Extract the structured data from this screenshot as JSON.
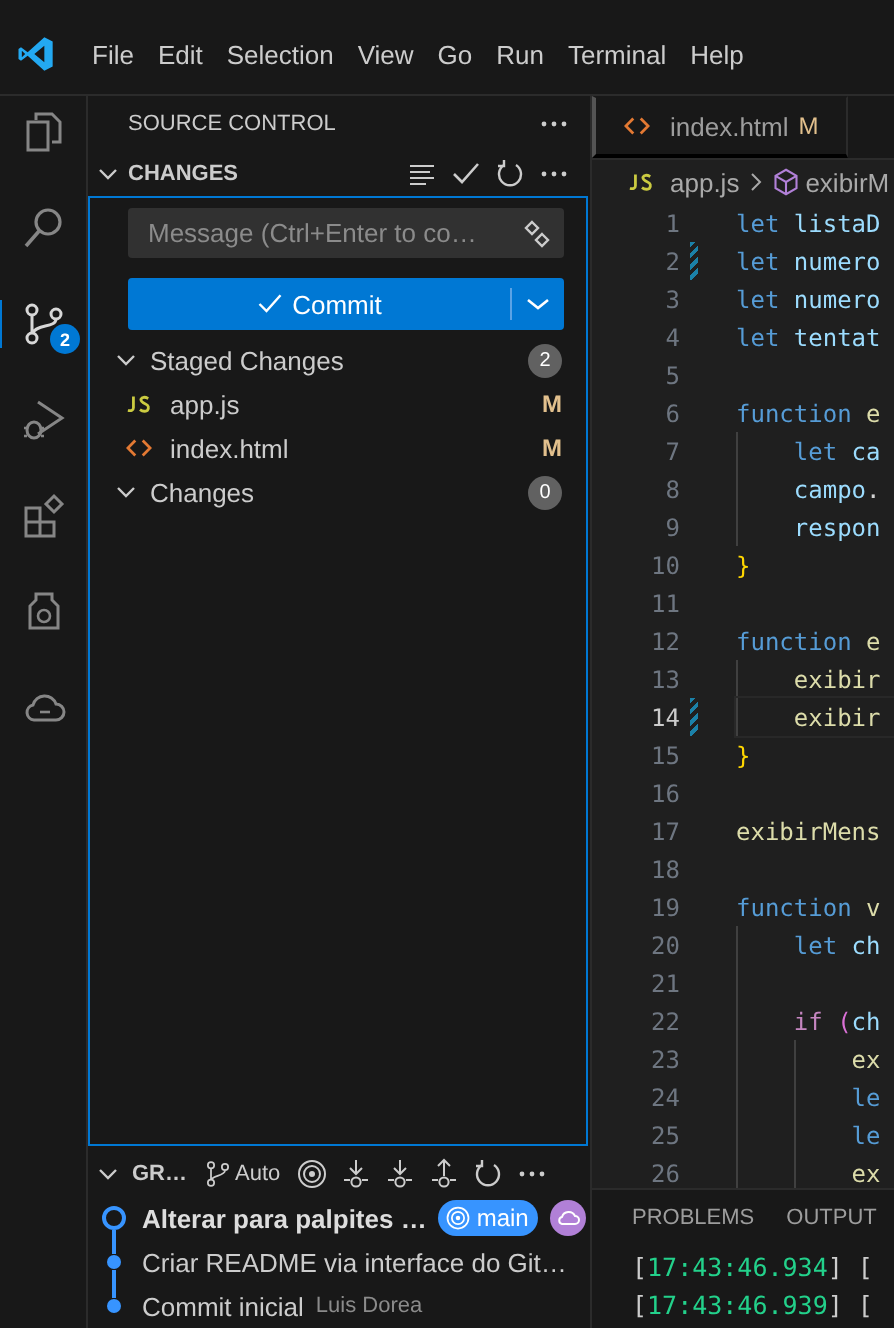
{
  "menu": [
    "File",
    "Edit",
    "Selection",
    "View",
    "Go",
    "Run",
    "Terminal",
    "Help"
  ],
  "activity_bar": [
    {
      "kind": "files",
      "selected": false
    },
    {
      "kind": "search",
      "selected": false
    },
    {
      "kind": "scm",
      "selected": true,
      "badge": "2"
    },
    {
      "kind": "debug",
      "selected": false
    },
    {
      "kind": "extensions",
      "selected": false
    },
    {
      "kind": "jar",
      "selected": false
    },
    {
      "kind": "cloud",
      "selected": false
    }
  ],
  "sidebar": {
    "title": "SOURCE CONTROL",
    "section": "CHANGES",
    "message": {
      "placeholder": "Message (Ctrl+Enter to co…"
    },
    "commit_button": "Commit",
    "groups": [
      {
        "label": "Staged Changes",
        "count": "2",
        "expanded": true,
        "files": [
          {
            "name": "app.js",
            "kind": "js",
            "status": "M"
          },
          {
            "name": "index.html",
            "kind": "html",
            "status": "M"
          }
        ]
      },
      {
        "label": "Changes",
        "count": "0",
        "expanded": true
      }
    ],
    "graph": {
      "title": "GR…",
      "branch_mode": "Auto",
      "commits": [
        {
          "message": "Alterar para palpites …",
          "current": true,
          "branch": "main"
        },
        {
          "message": "Criar README via interface do Git…",
          "current": false
        },
        {
          "message": "Commit inicial",
          "current": false,
          "author": "Luis Dorea"
        }
      ]
    }
  },
  "editor": {
    "tabs": [
      {
        "label": "index.html",
        "kind": "html",
        "status": "M",
        "selected": false
      }
    ],
    "breadcrumb": [
      "app.js",
      "exibirM"
    ],
    "lines": [
      {
        "number": "1",
        "kind": "top",
        "current": false,
        "modified": false,
        "tokens": [
          {
            "text": "let",
            "kind": "keyword"
          },
          {
            "text": " listaD",
            "kind": "variable"
          }
        ]
      },
      {
        "number": "2",
        "kind": "top",
        "current": false,
        "modified": true,
        "tokens": [
          {
            "text": "let",
            "kind": "keyword"
          },
          {
            "text": " numero",
            "kind": "variable"
          }
        ]
      },
      {
        "number": "3",
        "kind": "top",
        "current": false,
        "modified": false,
        "tokens": [
          {
            "text": "let",
            "kind": "keyword"
          },
          {
            "text": " numero",
            "kind": "variable"
          }
        ]
      },
      {
        "number": "4",
        "kind": "top",
        "current": false,
        "modified": false,
        "tokens": [
          {
            "text": "let",
            "kind": "keyword"
          },
          {
            "text": " tentat",
            "kind": "variable"
          }
        ]
      },
      {
        "number": "5",
        "kind": "top",
        "current": false,
        "modified": false
      },
      {
        "number": "6",
        "kind": "top",
        "current": false,
        "modified": false,
        "tokens": [
          {
            "text": "function",
            "kind": "keyword"
          },
          {
            "text": " e",
            "kind": "function"
          }
        ]
      },
      {
        "number": "7",
        "kind": "inner",
        "current": false,
        "modified": false,
        "tokens": [
          {
            "text": "let",
            "kind": "keyword"
          },
          {
            "text": " ca",
            "kind": "variable"
          }
        ]
      },
      {
        "number": "8",
        "kind": "inner",
        "current": false,
        "modified": false,
        "tokens": [
          {
            "text": "campo",
            "kind": "variable"
          },
          {
            "text": ".",
            "kind": "plain"
          }
        ]
      },
      {
        "number": "9",
        "kind": "inner",
        "current": false,
        "modified": false,
        "tokens": [
          {
            "text": "respon",
            "kind": "variable"
          }
        ]
      },
      {
        "number": "10",
        "kind": "top",
        "current": false,
        "modified": false,
        "tokens": [
          {
            "text": "}",
            "kind": "brace"
          }
        ]
      },
      {
        "number": "11",
        "kind": "top",
        "current": false,
        "modified": false
      },
      {
        "number": "12",
        "kind": "top",
        "current": false,
        "modified": false,
        "tokens": [
          {
            "text": "function",
            "kind": "keyword"
          },
          {
            "text": " e",
            "kind": "function"
          }
        ]
      },
      {
        "number": "13",
        "kind": "inner",
        "current": false,
        "modified": false,
        "tokens": [
          {
            "text": "exibir",
            "kind": "function"
          }
        ]
      },
      {
        "number": "14",
        "kind": "inner",
        "current": true,
        "modified": true,
        "tokens": [
          {
            "text": "exibir",
            "kind": "function"
          }
        ]
      },
      {
        "number": "15",
        "kind": "top",
        "current": false,
        "modified": false,
        "tokens": [
          {
            "text": "}",
            "kind": "brace"
          }
        ]
      },
      {
        "number": "16",
        "kind": "top",
        "current": false,
        "modified": false
      },
      {
        "number": "17",
        "kind": "top",
        "current": false,
        "modified": false,
        "tokens": [
          {
            "text": "exibirMens",
            "kind": "function"
          }
        ]
      },
      {
        "number": "18",
        "kind": "top",
        "current": false,
        "modified": false
      },
      {
        "number": "19",
        "kind": "top",
        "current": false,
        "modified": false,
        "tokens": [
          {
            "text": "function",
            "kind": "keyword"
          },
          {
            "text": " v",
            "kind": "function"
          }
        ]
      },
      {
        "number": "20",
        "kind": "inner",
        "current": false,
        "modified": false,
        "tokens": [
          {
            "text": "let",
            "kind": "keyword"
          },
          {
            "text": " ch",
            "kind": "variable"
          }
        ]
      },
      {
        "number": "21",
        "kind": "inner",
        "current": false,
        "modified": false
      },
      {
        "number": "22",
        "kind": "inner",
        "current": false,
        "modified": false,
        "tokens": [
          {
            "text": "if",
            "kind": "control"
          },
          {
            "text": " (",
            "kind": "paren"
          },
          {
            "text": "ch",
            "kind": "variable"
          }
        ]
      },
      {
        "number": "23",
        "kind": "nested",
        "current": false,
        "modified": false,
        "tokens": [
          {
            "text": "ex",
            "kind": "function"
          }
        ]
      },
      {
        "number": "24",
        "kind": "nested",
        "current": false,
        "modified": false,
        "tokens": [
          {
            "text": "le",
            "kind": "keyword"
          }
        ]
      },
      {
        "number": "25",
        "kind": "nested",
        "current": false,
        "modified": false,
        "tokens": [
          {
            "text": "le",
            "kind": "keyword"
          }
        ]
      },
      {
        "number": "26",
        "kind": "nested",
        "current": false,
        "modified": false,
        "tokens": [
          {
            "text": "ex",
            "kind": "function"
          }
        ]
      }
    ]
  },
  "panel": {
    "tabs": [
      {
        "label": "PROBLEMS",
        "selected": false
      },
      {
        "label": "OUTPUT",
        "selected": false
      }
    ],
    "lines": [
      {
        "tokens": [
          {
            "text": "[",
            "kind": "punct"
          },
          {
            "text": "17:43:46.934",
            "kind": "time"
          },
          {
            "text": "] [",
            "kind": "punct"
          }
        ]
      },
      {
        "tokens": [
          {
            "text": "[",
            "kind": "punct"
          },
          {
            "text": "17:43:46.939",
            "kind": "time"
          },
          {
            "text": "] [",
            "kind": "punct"
          }
        ]
      }
    ]
  }
}
